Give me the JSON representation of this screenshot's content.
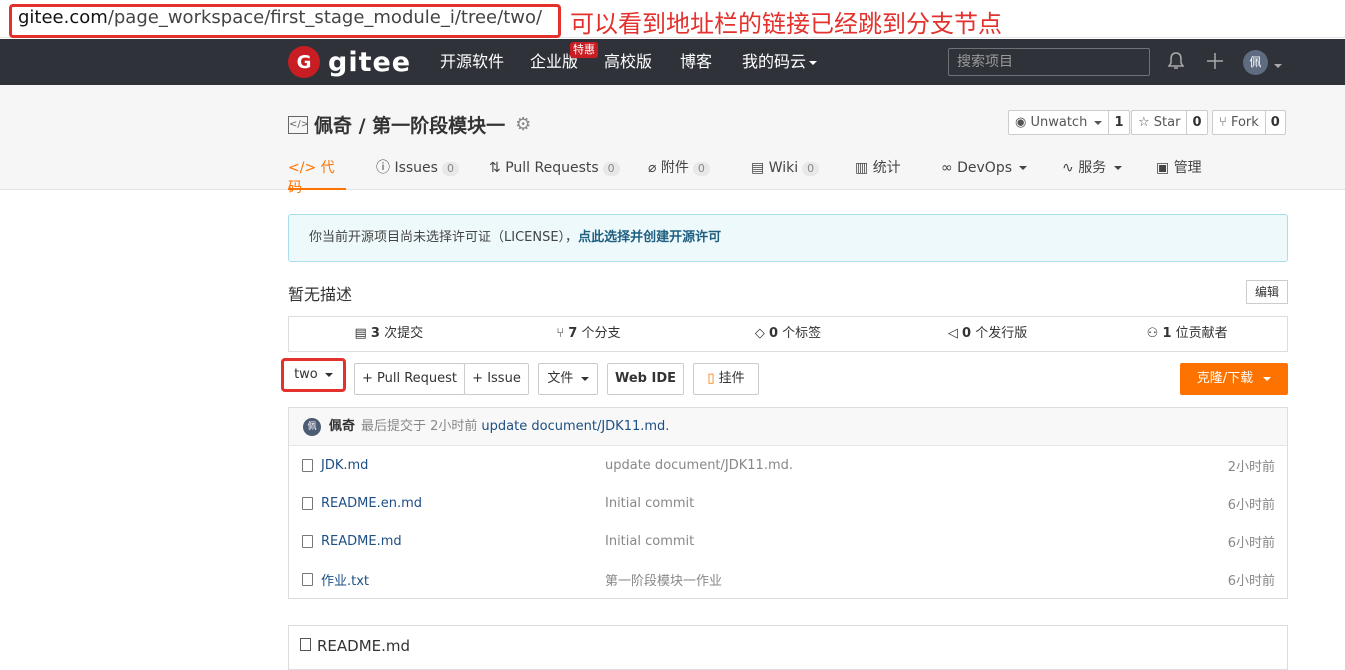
{
  "annotation": {
    "url_host": "gitee.com",
    "url_path": "/page_workspace/first_stage_module_i/tree/two/",
    "note": "可以看到地址栏的链接已经跳到分支节点"
  },
  "nav": {
    "logo": "gitee",
    "items": [
      "开源软件",
      "企业版",
      "高校版",
      "博客",
      "我的码云"
    ],
    "hot_badge": "特惠",
    "search_placeholder": "搜索项目",
    "avatar": "佩"
  },
  "repo": {
    "title": "佩奇 / 第一阶段模块一",
    "watch": {
      "label": "Unwatch",
      "count": "1"
    },
    "star": {
      "label": "Star",
      "count": "0"
    },
    "fork": {
      "label": "Fork",
      "count": "0"
    },
    "tabs": [
      {
        "label": "代码"
      },
      {
        "label": "Issues",
        "count": "0"
      },
      {
        "label": "Pull Requests",
        "count": "0"
      },
      {
        "label": "附件",
        "count": "0"
      },
      {
        "label": "Wiki",
        "count": "0"
      },
      {
        "label": "统计"
      },
      {
        "label": "DevOps"
      },
      {
        "label": "服务"
      },
      {
        "label": "管理"
      }
    ]
  },
  "license": {
    "text": "你当前开源项目尚未选择许可证（LICENSE），",
    "link": "点此选择并创建开源许可"
  },
  "description": "暂无描述",
  "edit_label": "编辑",
  "stats": [
    {
      "num": "3",
      "label": "次提交"
    },
    {
      "num": "7",
      "label": "个分支"
    },
    {
      "num": "0",
      "label": "个标签"
    },
    {
      "num": "0",
      "label": "个发行版"
    },
    {
      "num": "1",
      "label": "位贡献者"
    }
  ],
  "toolbar": {
    "branch": "two",
    "pull_request": "+ Pull Request",
    "issue": "+ Issue",
    "file": "文件",
    "webide": "Web IDE",
    "hang": "挂件",
    "clone": "克隆/下载"
  },
  "last_commit": {
    "avatar": "佩",
    "author": "佩奇",
    "meta": "最后提交于 2小时前",
    "message": "update document/JDK11.md."
  },
  "files": [
    {
      "name": "JDK.md",
      "commit": "update document/JDK11.md.",
      "time": "2小时前"
    },
    {
      "name": "README.en.md",
      "commit": "Initial commit",
      "time": "6小时前"
    },
    {
      "name": "README.md",
      "commit": "Initial commit",
      "time": "6小时前"
    },
    {
      "name": "作业.txt",
      "commit": "第一阶段模块一作业",
      "time": "6小时前"
    }
  ],
  "readme_title": "README.md"
}
